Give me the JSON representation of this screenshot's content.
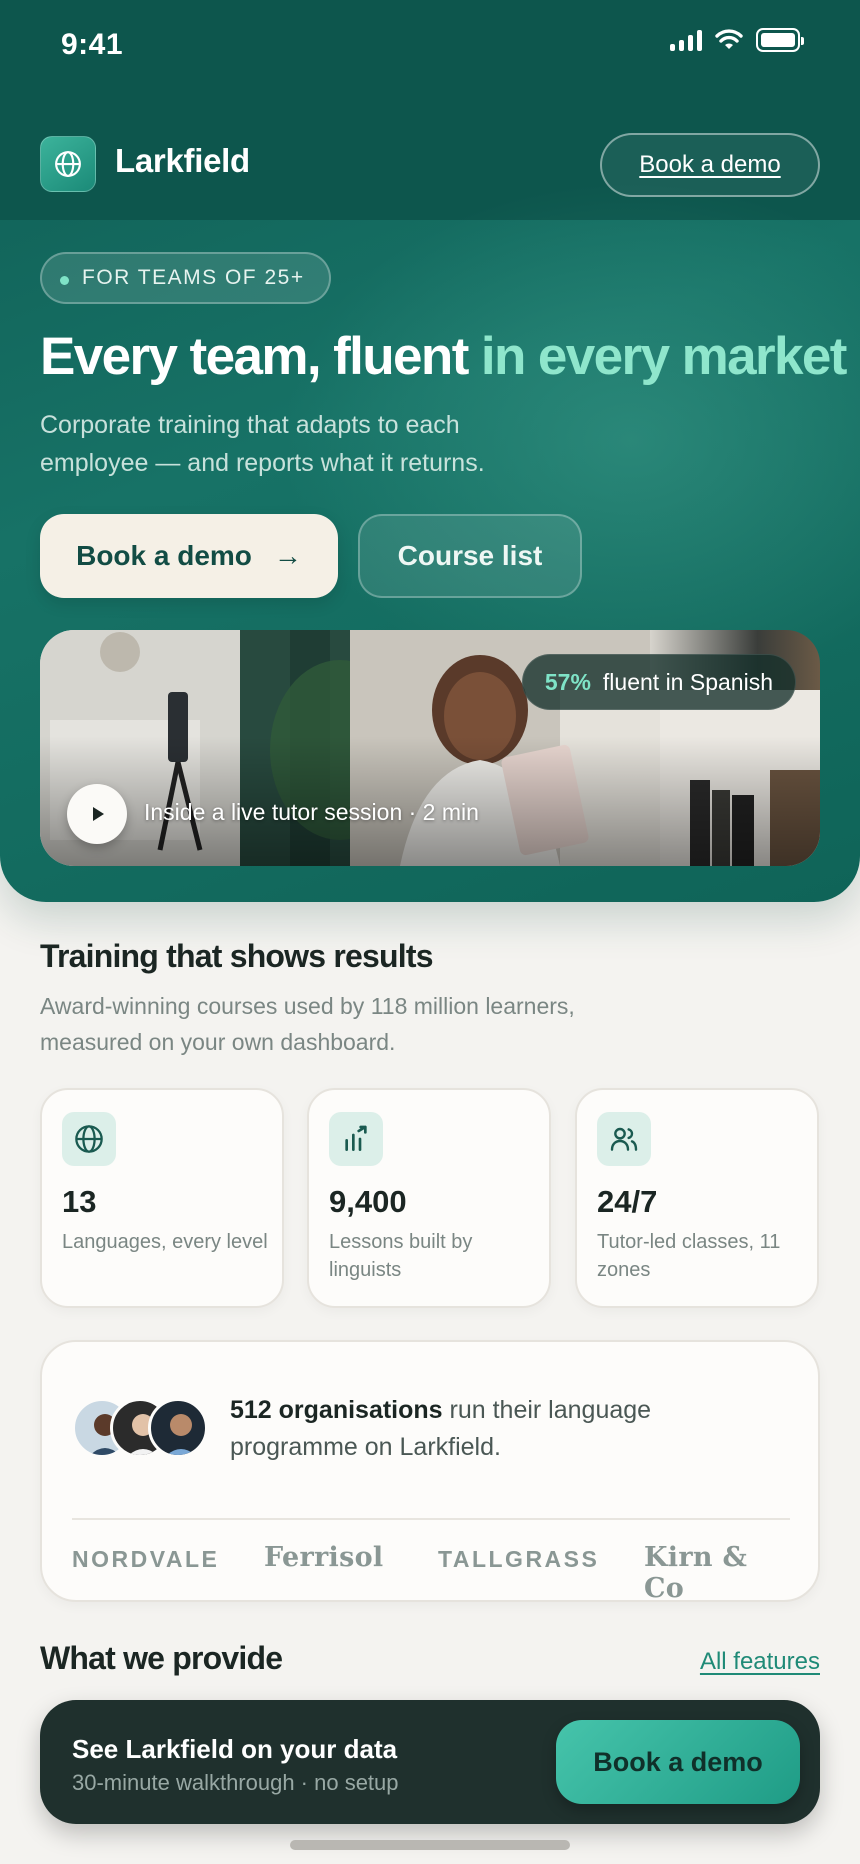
{
  "status_bar": {
    "time": "9:41"
  },
  "nav": {
    "brand": "Larkfield",
    "demo_label": "Book a demo"
  },
  "hero": {
    "pill": "FOR TEAMS OF 25+",
    "headline_main": "Every team, fluent ",
    "headline_accent": "in every market",
    "subline": "Corporate training that adapts to each employee — and reports what it returns.",
    "primary_cta": "Book a demo",
    "primary_cta_arrow": "→",
    "secondary_cta": "Course list"
  },
  "video": {
    "badge_pct": "57%",
    "badge_text": "fluent in Spanish",
    "caption": "Inside a live tutor session · 2 min"
  },
  "results": {
    "title": "Training that shows results",
    "subtitle": "Award-winning courses used by 118 million learners, measured on your own dashboard.",
    "stats": [
      {
        "icon": "globe-icon",
        "value": "13",
        "label": "Languages, every level"
      },
      {
        "icon": "chart-icon",
        "value": "9,400",
        "label": "Lessons built by linguists"
      },
      {
        "icon": "users-icon",
        "value": "24/7",
        "label": "Tutor-led classes, 11 zones"
      }
    ]
  },
  "orgs": {
    "count": "512 organisations",
    "text": " run their language programme on Larkfield.",
    "logos": [
      "NORDVALE",
      "Ferrisol",
      "TALLGRASS",
      "Kirn & Co"
    ]
  },
  "provide": {
    "title": "What we provide",
    "link": "All features"
  },
  "cta_bar": {
    "title": "See Larkfield on your data",
    "subtitle": "30-minute walkthrough · no setup",
    "button": "Book a demo"
  },
  "colors": {
    "brand": "#0f5d54",
    "accent": "#8fe6cc",
    "cta": "#2fb39b"
  }
}
